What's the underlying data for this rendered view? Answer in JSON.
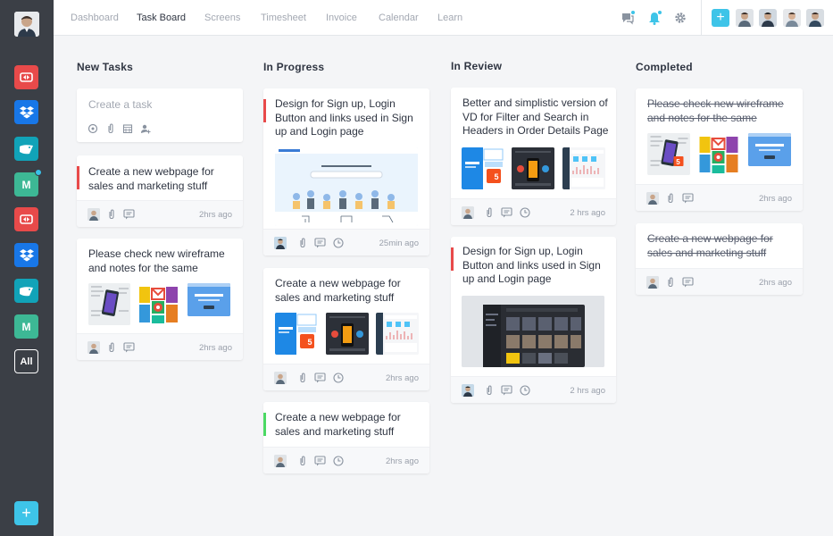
{
  "nav": {
    "items": [
      "Dashboard",
      "Task Board",
      "Screens",
      "Timesheet",
      "Invoice",
      "Calendar",
      "Learn"
    ],
    "active": "Task Board"
  },
  "sidebar": {
    "apps": [
      "red-app",
      "dropbox",
      "teal-app",
      "medium",
      "red-app",
      "dropbox",
      "teal-app",
      "medium"
    ],
    "all_label": "All",
    "add_label": "+"
  },
  "topbar": {
    "add_label": "+"
  },
  "columns": {
    "new": {
      "title": "New Tasks"
    },
    "progress": {
      "title": "In Progress"
    },
    "review": {
      "title": "In Review"
    },
    "completed": {
      "title": "Completed"
    }
  },
  "create_task": {
    "placeholder": "Create a task"
  },
  "cards": {
    "new1": {
      "text": "Create a new webpage for sales and marketing stuff",
      "time": "2hrs ago",
      "accent": "#e84a4a"
    },
    "new2": {
      "text": "Please check new wireframe and notes for the same",
      "time": "2hrs ago"
    },
    "prog1": {
      "text": "Design for Sign up, Login Button and links used in Sign up and Login page",
      "time": "25min ago",
      "accent": "#e84a4a"
    },
    "prog2": {
      "text": "Create a new webpage for sales and marketing stuff",
      "time": "2hrs ago"
    },
    "prog3": {
      "text": "Create a new webpage for sales and marketing stuff",
      "time": "2hrs ago",
      "accent": "#4cd964"
    },
    "rev1": {
      "text": "Better and simplistic version of VD for Filter and Search in Headers in Order Details Page",
      "time": "2 hrs ago"
    },
    "rev2": {
      "text": "Design for Sign up, Login Button and links used in Sign up and Login page",
      "time": "2 hrs ago",
      "accent": "#e84a4a"
    },
    "comp1": {
      "text": "Please check new wireframe and notes for the same",
      "time": "2hrs ago"
    },
    "comp2": {
      "text": "Create a new webpage for sales and marketing stuff",
      "time": "2hrs ago"
    }
  },
  "thumb_labels": {
    "badge": "5",
    "user_guide": "User Guide"
  },
  "colors": {
    "accent": "#3ec4e8",
    "sidebar": "#3b3f46",
    "red": "#e84a4a",
    "green": "#4cd964"
  }
}
